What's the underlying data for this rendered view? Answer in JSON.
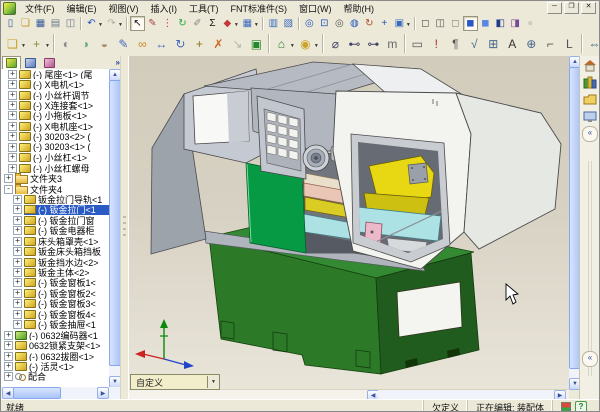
{
  "menu": {
    "items": [
      "文件(F)",
      "编辑(E)",
      "视图(V)",
      "插入(I)",
      "工具(T)",
      "FNT标准件(S)",
      "窗口(W)",
      "帮助(H)"
    ]
  },
  "window_controls": [
    {
      "name": "minimize-button",
      "glyph": "─"
    },
    {
      "name": "restore-button",
      "glyph": "❐"
    },
    {
      "name": "close-button",
      "glyph": "✕"
    }
  ],
  "toolbars": {
    "standard": [
      {
        "name": "new-document",
        "g": "▯",
        "c": "#3a5a9a"
      },
      {
        "name": "open",
        "g": "❏",
        "c": "#c9931a"
      },
      {
        "name": "save",
        "g": "▦",
        "c": "#3a5a9a"
      },
      {
        "name": "print",
        "g": "▤",
        "c": "#6a7a8a"
      },
      {
        "name": "print-preview",
        "g": "◫",
        "c": "#6a7a8a"
      },
      {
        "sep": true
      },
      {
        "name": "undo",
        "g": "↶",
        "c": "#2255bb",
        "dd": true
      },
      {
        "name": "redo",
        "g": "↷",
        "c": "#666",
        "dd": true,
        "dis": true
      },
      {
        "sep": true
      },
      {
        "name": "select",
        "g": "↖",
        "c": "#111",
        "on": true
      },
      {
        "name": "sketch",
        "g": "✎",
        "c": "#aa4444"
      },
      {
        "name": "rebuild-stoplight",
        "g": "⋮",
        "c": "#cc3333"
      },
      {
        "name": "rebuild",
        "g": "↻",
        "c": "#22aa44"
      },
      {
        "name": "measure",
        "g": "✐",
        "c": "#888888"
      },
      {
        "name": "equations",
        "g": "Σ",
        "c": "#111111"
      },
      {
        "name": "edit-color",
        "g": "◆",
        "c": "#c03a3a",
        "dd": true
      },
      {
        "name": "texture",
        "g": "▦",
        "c": "#3a6ac0",
        "dd": true
      },
      {
        "sep": true
      },
      {
        "name": "make-drawing",
        "g": "▥",
        "c": "#3a6ac0"
      },
      {
        "name": "make-assembly",
        "g": "▧",
        "c": "#3a6ac0"
      },
      {
        "sep": true
      },
      {
        "name": "zoom-fit",
        "g": "◎",
        "c": "#2255bb"
      },
      {
        "name": "zoom-area",
        "g": "⊡",
        "c": "#2255bb"
      },
      {
        "name": "zoom-in-out",
        "g": "◎",
        "c": "#555555"
      },
      {
        "name": "zoom-selection",
        "g": "◍",
        "c": "#2255bb"
      },
      {
        "name": "rotate-view",
        "g": "↻",
        "c": "#b04a2a"
      },
      {
        "name": "pan",
        "g": "+",
        "c": "#2255bb"
      },
      {
        "name": "standard-views",
        "g": "▣",
        "c": "#3a6ac0",
        "dd": true
      },
      {
        "sep": true
      },
      {
        "name": "wireframe",
        "g": "◻",
        "c": "#555555"
      },
      {
        "name": "hidden-lines-visible",
        "g": "◫",
        "c": "#555555"
      },
      {
        "name": "hidden-lines-removed",
        "g": "◻",
        "c": "#888888"
      },
      {
        "name": "shaded-with-edges",
        "g": "◼",
        "c": "#2a56c6",
        "on": true
      },
      {
        "name": "shaded",
        "g": "◼",
        "c": "#5a86e6"
      },
      {
        "name": "shadows-in-shaded",
        "g": "◧",
        "c": "#223a8a"
      },
      {
        "name": "section-view",
        "g": "◨",
        "c": "#7a4a9a"
      },
      {
        "name": "realview",
        "g": "●",
        "c": "#aaaaaa",
        "dis": true
      }
    ],
    "assembly": [
      {
        "name": "insert-component",
        "g": "❏",
        "c": "#c9a22a",
        "dd": true
      },
      {
        "name": "smart-fastener-insert",
        "g": "+",
        "c": "#8a8a4a",
        "dd": true
      },
      {
        "sep": true
      },
      {
        "name": "hide-show-component",
        "g": "◐",
        "c": "#888888"
      },
      {
        "name": "change-transparency",
        "g": "◑",
        "c": "#66aa88"
      },
      {
        "name": "change-suppression",
        "g": "◒",
        "c": "#aa8866"
      },
      {
        "name": "edit-component",
        "g": "✎",
        "c": "#4466bb"
      },
      {
        "name": "mate",
        "g": "∞",
        "c": "#cc8822"
      },
      {
        "name": "move-component",
        "g": "↔",
        "c": "#4466bb"
      },
      {
        "name": "rotate-component",
        "g": "↻",
        "c": "#4466bb"
      },
      {
        "name": "smart-fasteners",
        "g": "+",
        "c": "#887722"
      },
      {
        "name": "exploded-view",
        "g": "✗",
        "c": "#cc6622"
      },
      {
        "name": "explode-line-sketch",
        "g": "↘",
        "c": "#777777",
        "dis": true
      },
      {
        "name": "interference-detection",
        "g": "▣",
        "c": "#22882a"
      },
      {
        "sep": true
      },
      {
        "name": "simulation",
        "g": "⌂",
        "c": "#2a7a2a",
        "dd": true
      },
      {
        "name": "physical-dynamics",
        "g": "◉",
        "c": "#c9a22a",
        "dd": true
      },
      {
        "sep": true
      },
      {
        "name": "smart-dimension",
        "g": "⌀",
        "c": "#444466"
      },
      {
        "name": "horizontal-dimension",
        "g": "⊷",
        "c": "#444466"
      },
      {
        "name": "vertical-dimension",
        "g": "⊶",
        "c": "#444466"
      },
      {
        "name": "model-items",
        "g": "m",
        "c": "#666666"
      },
      {
        "sep": true
      },
      {
        "name": "note",
        "g": "▭",
        "c": "#555555"
      },
      {
        "name": "balloon",
        "g": "!",
        "c": "#aa3333"
      },
      {
        "name": "stacked-balloon",
        "g": "¶",
        "c": "#555555"
      },
      {
        "name": "surface-finish",
        "g": "√",
        "c": "#446688"
      },
      {
        "name": "geometric-tolerance",
        "g": "⊞",
        "c": "#446688"
      },
      {
        "name": "datum-feature",
        "g": "A",
        "c": "#333333"
      },
      {
        "name": "datum-target",
        "g": "⊕",
        "c": "#446688"
      },
      {
        "name": "weld-symbol",
        "g": "⌐",
        "c": "#555555"
      },
      {
        "name": "centerline",
        "g": "L",
        "c": "#555555"
      },
      {
        "sep": true
      },
      {
        "name": "center-mark",
        "g": "⇔",
        "c": "#446688"
      },
      {
        "name": "area-hatch",
        "g": "▨",
        "c": "#555555"
      },
      {
        "name": "block",
        "g": "▣",
        "c": "#555555"
      },
      {
        "name": "revision-symbol",
        "g": "∆",
        "c": "#555555"
      },
      {
        "name": "library-feature",
        "g": "∞",
        "c": "#777777"
      },
      {
        "sep": true
      },
      {
        "name": "erase-annotation",
        "g": "✗",
        "c": "#cc2222"
      }
    ]
  },
  "feature_tree": {
    "tabs": [
      {
        "name": "featuremanager-tab",
        "active": true
      },
      {
        "name": "propertymanager-tab",
        "active": false
      },
      {
        "name": "configurationmanager-tab",
        "active": false
      }
    ],
    "overflow_chevron": "»",
    "items": [
      {
        "label": "(-) 尾座<1> (尾",
        "icon": "part",
        "lvl": 1,
        "exp": "+"
      },
      {
        "label": "(-) X电机<1>",
        "icon": "part",
        "lvl": 1,
        "exp": "+"
      },
      {
        "label": "(-) 小丝杆调节",
        "icon": "part",
        "lvl": 1,
        "exp": "+"
      },
      {
        "label": "(-) X连接套<1>",
        "icon": "part",
        "lvl": 1,
        "exp": "+"
      },
      {
        "label": "(-) 小拖板<1>",
        "icon": "part",
        "lvl": 1,
        "exp": "+"
      },
      {
        "label": "(-) X电机座<1>",
        "icon": "part",
        "lvl": 1,
        "exp": "+"
      },
      {
        "label": "(-) 30203<2> (",
        "icon": "part",
        "lvl": 1,
        "exp": "+"
      },
      {
        "label": "(-) 30203<1> (",
        "icon": "part",
        "lvl": 1,
        "exp": "+"
      },
      {
        "label": "(-) 小丝杠<1>",
        "icon": "part",
        "lvl": 1,
        "exp": "+"
      },
      {
        "label": "(-) 小丝杠螺母",
        "icon": "part",
        "lvl": 1,
        "exp": "+"
      },
      {
        "label": "文件夹3",
        "icon": "folder",
        "lvl": 0,
        "exp": "+"
      },
      {
        "label": "文件夹4",
        "icon": "folder",
        "lvl": 0,
        "exp": "-"
      },
      {
        "label": "钣金拉门导轨<1",
        "icon": "part",
        "lvl": 2,
        "exp": "+"
      },
      {
        "label": "(-) 钣金拉门<1",
        "icon": "part",
        "lvl": 2,
        "exp": "+",
        "sel": true
      },
      {
        "label": "(-) 钣金拉门窗",
        "icon": "part",
        "lvl": 2,
        "exp": "+"
      },
      {
        "label": "(-) 钣金电器柜",
        "icon": "part",
        "lvl": 2,
        "exp": "+"
      },
      {
        "label": "床头箱罩壳<1>",
        "icon": "part",
        "lvl": 2,
        "exp": "+"
      },
      {
        "label": "钣金床头箱挡板",
        "icon": "part",
        "lvl": 2,
        "exp": "+"
      },
      {
        "label": "钣金挡水边<2>",
        "icon": "part",
        "lvl": 2,
        "exp": "+"
      },
      {
        "label": "钣金主体<2>",
        "icon": "part",
        "lvl": 2,
        "exp": "+"
      },
      {
        "label": "(-) 钣金窗板1<",
        "icon": "part",
        "lvl": 2,
        "exp": "+"
      },
      {
        "label": "(-) 钣金窗板2<",
        "icon": "part",
        "lvl": 2,
        "exp": "+"
      },
      {
        "label": "(-) 钣金窗板3<",
        "icon": "part",
        "lvl": 2,
        "exp": "+"
      },
      {
        "label": "(-) 钣金窗板4<",
        "icon": "part",
        "lvl": 2,
        "exp": "+"
      },
      {
        "label": "(-) 钣金抽屉<1",
        "icon": "part",
        "lvl": 2,
        "exp": "+"
      },
      {
        "label": "(-) 0632编码器<1",
        "icon": "assembly",
        "lvl": 0,
        "exp": "+"
      },
      {
        "label": "0632锁紧支架<1>",
        "icon": "part",
        "lvl": 0,
        "exp": "+"
      },
      {
        "label": "(-) 0632拔圈<1>",
        "icon": "part",
        "lvl": 0,
        "exp": "+"
      },
      {
        "label": "(-) 活灵<1>",
        "icon": "part",
        "lvl": 0,
        "exp": "+"
      },
      {
        "label": "配合",
        "icon": "mates",
        "lvl": 0,
        "exp": "+"
      }
    ]
  },
  "viewport": {
    "view_combo_value": "自定义"
  },
  "task_pane": {
    "icons": [
      {
        "name": "solidworks-resources",
        "kind": "home"
      },
      {
        "name": "design-library",
        "kind": "books"
      },
      {
        "name": "file-explorer",
        "kind": "folder"
      },
      {
        "name": "view-palette",
        "kind": "screen"
      }
    ],
    "collapse_chevron": "«"
  },
  "status_bar": {
    "ready": "就绪",
    "define_state": "欠定义",
    "editing": "正在编辑: 装配体"
  },
  "colors": {
    "selection_blue": "#2a5ac4",
    "base_green": "#2c7a28",
    "base_green_dark": "#1f5c1d",
    "door_green": "#079a44",
    "cover_white": "#f3f4f0",
    "cover_white_shade": "#e6e8e3",
    "cover_gray": "#b6bac3",
    "hood_gray": "#c5c9d1",
    "part_yellow": "#e8d713",
    "part_cyan": "#ade2e4",
    "part_pink": "#ecb9ca",
    "slab_pink": "#eac6b6"
  }
}
